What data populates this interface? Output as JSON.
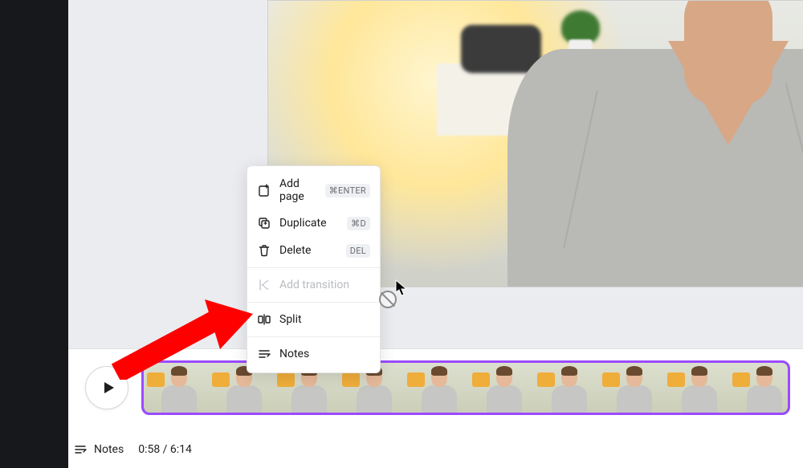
{
  "context_menu": {
    "items": [
      {
        "label": "Add page",
        "shortcut": "⌘ENTER"
      },
      {
        "label": "Duplicate",
        "shortcut": "⌘D"
      },
      {
        "label": "Delete",
        "shortcut": "DEL"
      },
      {
        "label": "Add transition",
        "shortcut": null
      },
      {
        "label": "Split",
        "shortcut": null
      },
      {
        "label": "Notes",
        "shortcut": null
      }
    ]
  },
  "bottom": {
    "notes_label": "Notes",
    "time": "0:58 / 6:14"
  }
}
